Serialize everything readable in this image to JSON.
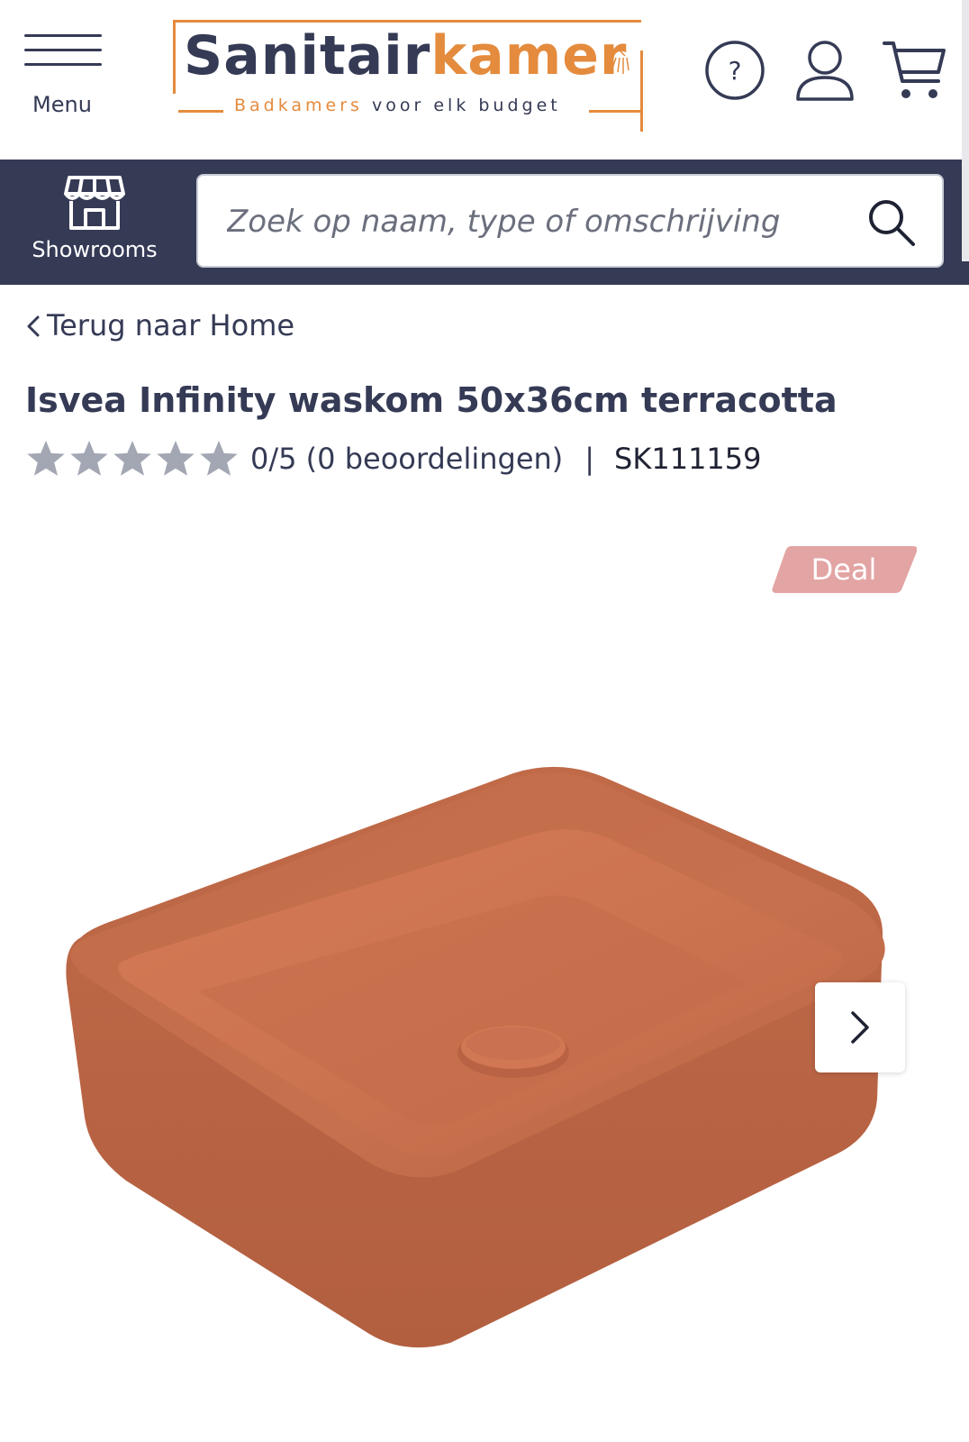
{
  "header": {
    "menu_label": "Menu",
    "logo": {
      "part1": "Sanitair",
      "part2": "kamer",
      "tagline_part1": "Badkamers",
      "tagline_part2": "voor elk budget"
    },
    "icons": [
      "help-icon",
      "account-icon",
      "cart-icon"
    ]
  },
  "search": {
    "showrooms_label": "Showrooms",
    "placeholder": "Zoek op naam, type of omschrijving"
  },
  "breadcrumb": {
    "back_label": "Terug naar Home"
  },
  "product": {
    "title": "Isvea Infinity waskom 50x36cm terracotta",
    "rating_text": "0/5 (0 beoordelingen)",
    "separator": "|",
    "sku": "SK111159",
    "stars_filled": 0,
    "stars_total": 5,
    "badge": "Deal"
  },
  "colors": {
    "brand_dark": "#353a55",
    "brand_orange": "#e48b3d",
    "badge_pink": "#e3a4a4",
    "star_gray": "#a2a7b3",
    "product_terracotta": "#c8704f"
  }
}
